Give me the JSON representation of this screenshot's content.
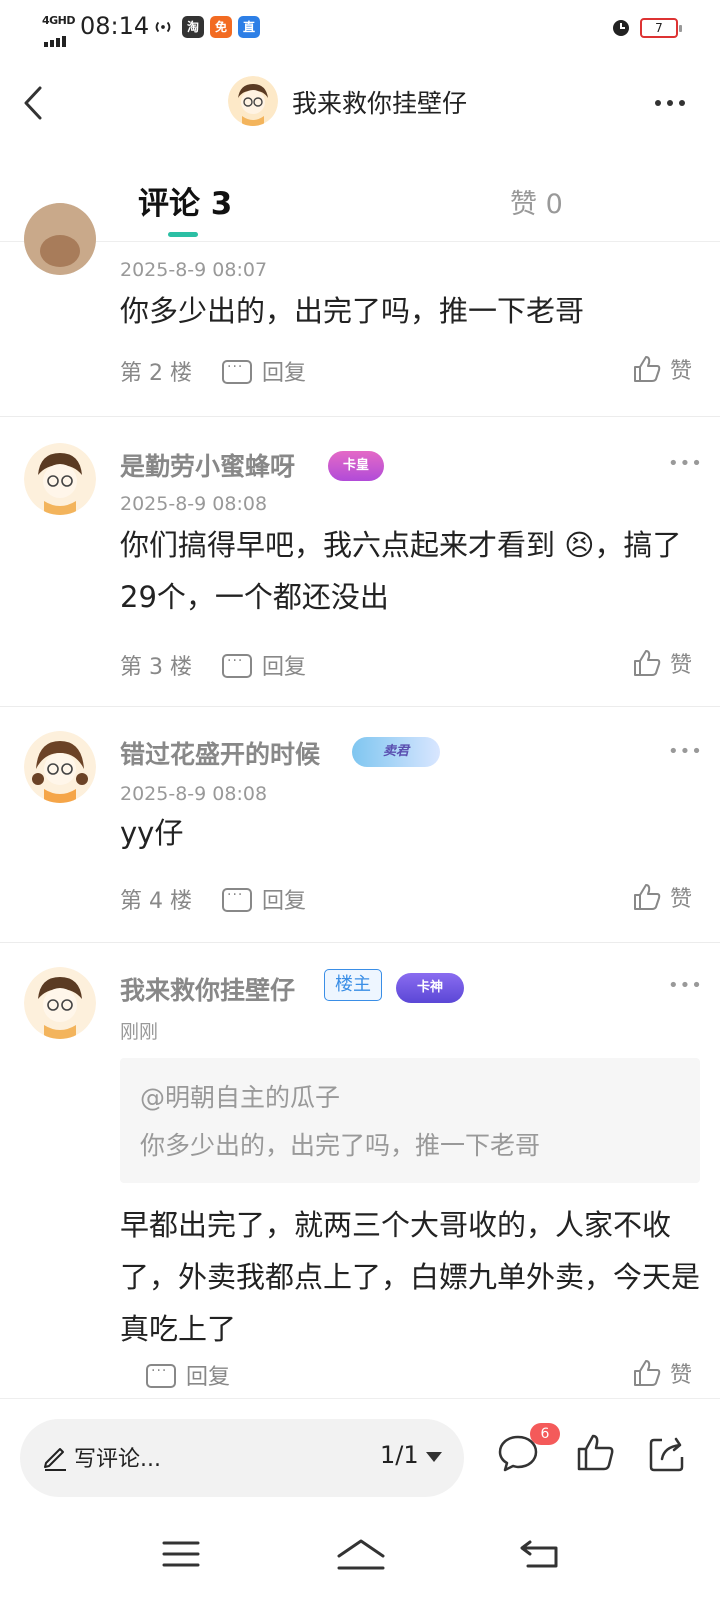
{
  "status_bar": {
    "network": "4GHD",
    "time": "08:14",
    "apps": [
      "淘",
      "免",
      "直"
    ],
    "battery": "7"
  },
  "header": {
    "title": "我来救你挂壁仔"
  },
  "tabs": {
    "comments_label": "评论 3",
    "likes_label": "赞 0"
  },
  "comments": [
    {
      "time": "2025-8-9 08:07",
      "content": "你多少出的，出完了吗，推一下老哥",
      "floor": "第 2 楼",
      "reply_label": "回复",
      "like_label": "赞"
    },
    {
      "username": "是勤劳小蜜蜂呀",
      "badge": "卡皇",
      "time": "2025-8-9 08:08",
      "content": "你们搞得早吧，我六点起来才看到 😣，搞了29个，一个都还没出",
      "floor": "第 3 楼",
      "reply_label": "回复",
      "like_label": "赞"
    },
    {
      "username": "错过花盛开的时候",
      "badge": "卖君",
      "time": "2025-8-9 08:08",
      "content": "yy仔",
      "floor": "第 4 楼",
      "reply_label": "回复",
      "like_label": "赞"
    },
    {
      "username": "我来救你挂壁仔",
      "host_tag": "楼主",
      "badge": "卡神",
      "time": "刚刚",
      "quote_user": "@明朝自主的瓜子",
      "quote_text": "你多少出的，出完了吗，推一下老哥",
      "content": "早都出完了，就两三个大哥收的，人家不收了，外卖我都点上了，白嫖九单外卖，今天是真吃上了",
      "reply_label": "回复",
      "like_label": "赞"
    }
  ],
  "bottom_bar": {
    "write_placeholder": "写评论...",
    "page_indicator": "1/1",
    "comment_count": "6"
  },
  "colors": {
    "accent": "#2bbfa4",
    "host_blue": "#3a8ee6",
    "notify_red": "#f45a5a"
  }
}
